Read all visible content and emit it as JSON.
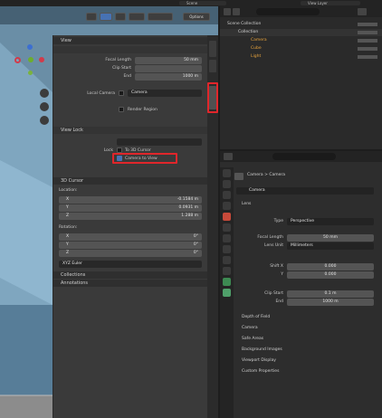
{
  "topbar": {
    "scene_label": "Scene",
    "view_layer_label": "View Layer"
  },
  "viewport": {
    "options_label": "Options"
  },
  "n_panel": {
    "view_section": "View",
    "lens_section": "",
    "focal_length_label": "Focal Length",
    "focal_length_value": "50 mm",
    "clip_start_label": "Clip Start",
    "clip_end_label": "End",
    "clip_end_value": "1000 m",
    "local_camera_label": "Local Camera",
    "local_camera_value": "Camera",
    "render_region_label": "Render Region",
    "view_lock_section": "View Lock",
    "lock_label": "Lock",
    "lock_3d_cursor": "To 3D Cursor",
    "lock_camera_to_view": "Camera to View",
    "cursor_section": "3D Cursor",
    "location_label": "Location:",
    "loc": [
      {
        "axis": "X",
        "value": "-0.1584 m"
      },
      {
        "axis": "Y",
        "value": "0.0931 m"
      },
      {
        "axis": "Z",
        "value": "1.288 m"
      }
    ],
    "rotation_label": "Rotation:",
    "rot": [
      {
        "axis": "X",
        "value": "0°"
      },
      {
        "axis": "Y",
        "value": "0°"
      },
      {
        "axis": "Z",
        "value": "0°"
      }
    ],
    "rotation_mode": "XYZ Euler",
    "collections_section": "Collections",
    "annotations_section": "Annotations"
  },
  "outliner": {
    "scene_collection": "Scene Collection",
    "collection": "Collection",
    "items": [
      "Camera",
      "Cube",
      "Light"
    ]
  },
  "properties": {
    "breadcrumb_camera": "Camera",
    "breadcrumb_data": "Camera",
    "data_name": "Camera",
    "lens_section": "Lens",
    "type_label": "Type",
    "type_value": "Perspective",
    "focal_length_label": "Focal Length",
    "focal_length_value": "50 mm",
    "lens_unit_label": "Lens Unit",
    "lens_unit_value": "Millimeters",
    "shift_x_label": "Shift X",
    "shift_x_value": "0.000",
    "shift_y_label": "Y",
    "shift_y_value": "0.000",
    "clip_start_label": "Clip Start",
    "clip_start_value": "0.1 m",
    "clip_end_label": "End",
    "clip_end_value": "1000 m",
    "sections": [
      "Depth of Field",
      "Camera",
      "Safe Areas",
      "Background Images",
      "Viewport Display",
      "Custom Properties"
    ]
  }
}
